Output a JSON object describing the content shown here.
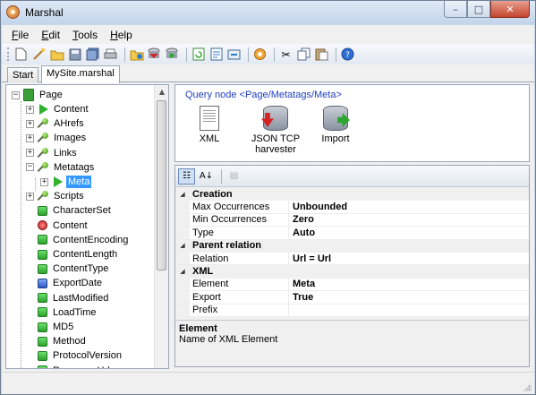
{
  "window": {
    "title": "Marshal",
    "minimize": "–",
    "maximize": "□",
    "close": "✕"
  },
  "menu": [
    {
      "underline": "F",
      "rest": "ile"
    },
    {
      "underline": "E",
      "rest": "dit"
    },
    {
      "underline": "T",
      "rest": "ools"
    },
    {
      "underline": "H",
      "rest": "elp"
    }
  ],
  "toolbar": {
    "icons": [
      "new-icon",
      "wand-icon",
      "open-folder-icon",
      "save-icon",
      "save-all-icon",
      "print-icon",
      "fetch-icon",
      "run-icon",
      "export-icon",
      "refresh-icon",
      "script-icon",
      "sync-icon",
      "settings-icon",
      "cut-icon",
      "copy-icon",
      "paste-icon",
      "help-icon"
    ]
  },
  "tabs": [
    "Start",
    "MySite.marshal"
  ],
  "tree": {
    "root": "Page",
    "items": [
      {
        "label": "Content",
        "icon": "play",
        "toggle": "+"
      },
      {
        "label": "AHrefs",
        "icon": "pin",
        "toggle": "+"
      },
      {
        "label": "Images",
        "icon": "pin",
        "toggle": "+"
      },
      {
        "label": "Links",
        "icon": "pin",
        "toggle": "+"
      },
      {
        "label": "Metatags",
        "icon": "pin",
        "toggle": "−"
      },
      {
        "label": "Meta",
        "icon": "play",
        "toggle": "+",
        "selected": true
      },
      {
        "label": "Scripts",
        "icon": "pin",
        "toggle": "+"
      },
      {
        "label": "CharacterSet",
        "icon": "green"
      },
      {
        "label": "Content",
        "icon": "red"
      },
      {
        "label": "ContentEncoding",
        "icon": "green"
      },
      {
        "label": "ContentLength",
        "icon": "green"
      },
      {
        "label": "ContentType",
        "icon": "green"
      },
      {
        "label": "ExportDate",
        "icon": "blue"
      },
      {
        "label": "LastModified",
        "icon": "green"
      },
      {
        "label": "LoadTime",
        "icon": "green"
      },
      {
        "label": "MD5",
        "icon": "green"
      },
      {
        "label": "Method",
        "icon": "green"
      },
      {
        "label": "ProtocolVersion",
        "icon": "green"
      },
      {
        "label": "ResponseUrl",
        "icon": "green"
      }
    ]
  },
  "query": {
    "title": "Query node <Page/Metatags/Meta>",
    "actions": [
      {
        "label": "XML"
      },
      {
        "label": "JSON TCP harvester"
      },
      {
        "label": "Import"
      }
    ]
  },
  "properties": {
    "categories": [
      {
        "name": "Creation",
        "rows": [
          {
            "name": "Max Occurrences",
            "value": "Unbounded"
          },
          {
            "name": "Min Occurrences",
            "value": "Zero"
          },
          {
            "name": "Type",
            "value": "Auto"
          }
        ]
      },
      {
        "name": "Parent relation",
        "rows": [
          {
            "name": "Relation",
            "value": "Url = Url"
          }
        ]
      },
      {
        "name": "XML",
        "rows": [
          {
            "name": "Element",
            "value": "Meta"
          },
          {
            "name": "Export",
            "value": "True"
          },
          {
            "name": "Prefix",
            "value": ""
          }
        ]
      }
    ],
    "description": {
      "title": "Element",
      "text": "Name of XML Element"
    }
  }
}
